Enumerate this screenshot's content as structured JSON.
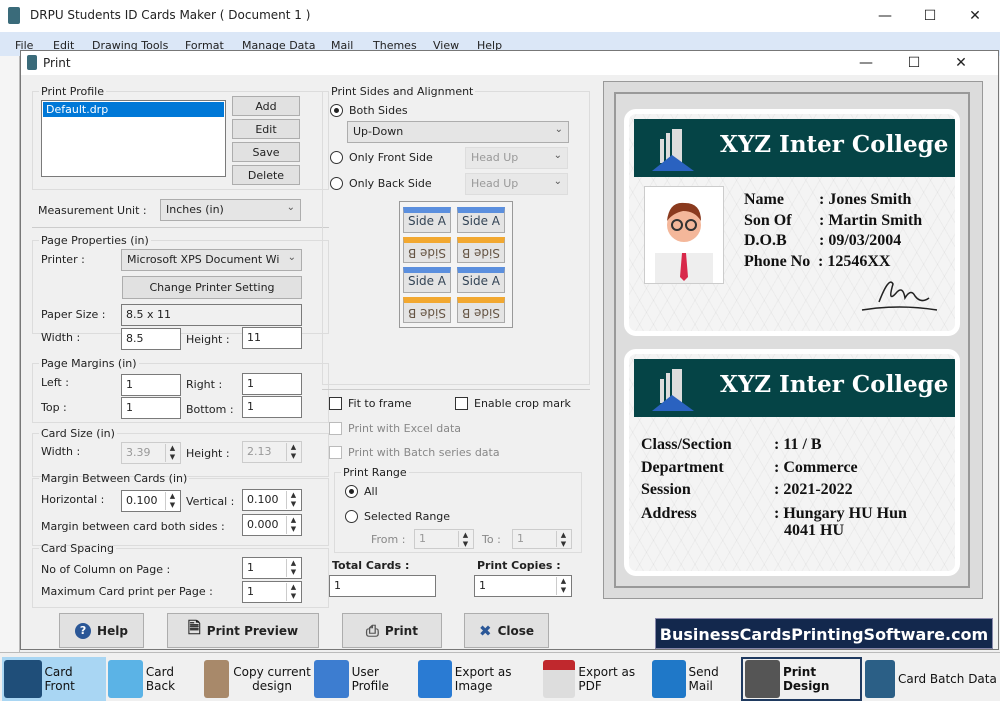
{
  "app": {
    "title": "DRPU Students ID Cards Maker ( Document 1 )",
    "menu": [
      "File",
      "Edit",
      "Drawing Tools",
      "Format",
      "Manage Data",
      "Mail",
      "Themes",
      "View",
      "Help"
    ]
  },
  "dialog": {
    "title": "Print",
    "profile": {
      "legend": "Print Profile",
      "items": [
        "Default.drp"
      ],
      "add": "Add",
      "edit": "Edit",
      "save": "Save",
      "delete": "Delete"
    },
    "measurement": {
      "label": "Measurement Unit :",
      "value": "Inches (in)"
    },
    "page": {
      "legend": "Page Properties (in)",
      "printer_label": "Printer :",
      "printer": "Microsoft XPS Document Wi",
      "change": "Change Printer Setting",
      "paper_label": "Paper Size :",
      "paper": "8.5 x 11",
      "width_label": "Width :",
      "width": "8.5",
      "height_label": "Height :",
      "height": "11"
    },
    "margins": {
      "legend": "Page Margins (in)",
      "left_label": "Left :",
      "left": "1",
      "right_label": "Right :",
      "right": "1",
      "top_label": "Top :",
      "top": "1",
      "bottom_label": "Bottom :",
      "bottom": "1"
    },
    "cardsize": {
      "legend": "Card Size (in)",
      "width_label": "Width :",
      "width": "3.39",
      "height_label": "Height :",
      "height": "2.13"
    },
    "between": {
      "legend": "Margin Between Cards (in)",
      "h_label": "Horizontal :",
      "h": "0.100",
      "v_label": "Vertical :",
      "v": "0.100",
      "both_label": "Margin between card both sides :",
      "both": "0.000"
    },
    "spacing": {
      "legend": "Card Spacing",
      "cols_label": "No of Column on Page :",
      "cols": "1",
      "max_label": "Maximum Card print per Page :",
      "max": "1"
    },
    "sides": {
      "legend": "Print Sides and Alignment",
      "both": "Both Sides",
      "both_value": "Up-Down",
      "front": "Only Front Side",
      "front_value": "Head Up",
      "back": "Only Back Side",
      "back_value": "Head Up",
      "side_a": "Side A",
      "side_b": "Side B"
    },
    "options": {
      "fit": "Fit to frame",
      "crop": "Enable crop mark",
      "excel": "Print with Excel data",
      "batch": "Print with Batch series data"
    },
    "range": {
      "legend": "Print Range",
      "all": "All",
      "selected": "Selected Range",
      "from_label": "From :",
      "from": "1",
      "to_label": "To :",
      "to": "1"
    },
    "totals": {
      "total_label": "Total Cards :",
      "total": "1",
      "copies_label": "Print Copies :",
      "copies": "1"
    },
    "buttons": {
      "help": "Help",
      "preview": "Print Preview",
      "print": "Print",
      "close": "Close"
    }
  },
  "card_front": {
    "college": "XYZ Inter College",
    "fields": [
      [
        "Name",
        ": Jones Smith"
      ],
      [
        "Son Of",
        ": Martin Smith"
      ],
      [
        "D.O.B",
        ": 09/03/2004"
      ],
      [
        "Phone No",
        ": 12546XX"
      ]
    ]
  },
  "card_back": {
    "college": "XYZ Inter College",
    "fields": [
      [
        "Class/Section",
        ": 11 / B"
      ],
      [
        "Department",
        ": Commerce"
      ],
      [
        "Session",
        ": 2021-2022"
      ],
      [
        "Address",
        ": Hungary HU Hun"
      ]
    ],
    "address_line2": "4041 HU"
  },
  "watermark": "BusinessCardsPrintingSoftware.com",
  "toolbar": [
    "Card Front",
    "Card Back",
    "Copy current design",
    "User Profile",
    "Export as Image",
    "Export as PDF",
    "Send Mail",
    "Print Design",
    "Card Batch Data"
  ],
  "colors": {
    "card_header": "#054446",
    "selection": "#0078d7",
    "watermark_bg": "#13284d"
  }
}
